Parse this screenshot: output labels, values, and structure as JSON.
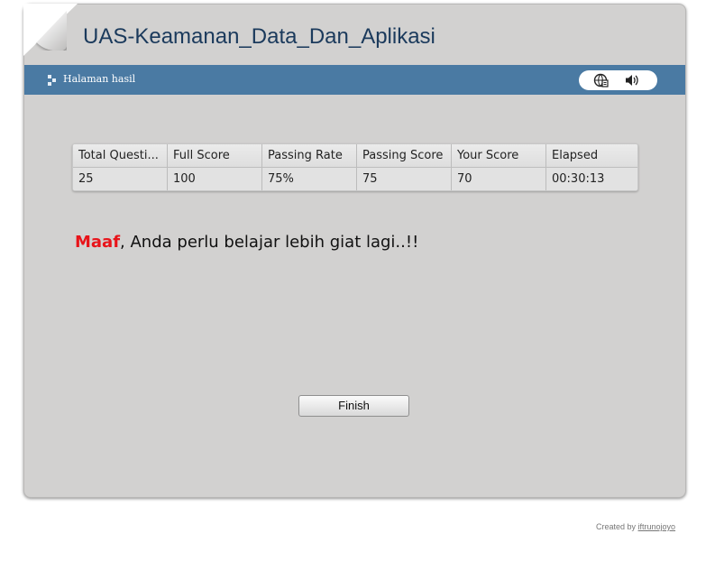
{
  "app": {
    "title": "UAS-Keamanan_Data_Dan_Aplikasi"
  },
  "navbar": {
    "label": "Halaman hasil",
    "icons": [
      "web-globe-icon",
      "speaker-volume-icon"
    ]
  },
  "results": {
    "headers": [
      "Total Questi...",
      "Full Score",
      "Passing Rate",
      "Passing Score",
      "Your Score",
      "Elapsed"
    ],
    "values": [
      "25",
      "100",
      "75%",
      "75",
      "70",
      "00:30:13"
    ]
  },
  "message": {
    "highlight": "Maaf",
    "text": ", Anda perlu belajar lebih giat lagi..!!"
  },
  "finish_button": {
    "label": "Finish"
  },
  "footer": {
    "prefix": "Created by ",
    "link": "iftrunojoyo"
  },
  "colors": {
    "navbar": "#4a7aa3",
    "panel": "#d2d1d0",
    "title": "#1b3a5c",
    "highlight": "#e8141a"
  }
}
